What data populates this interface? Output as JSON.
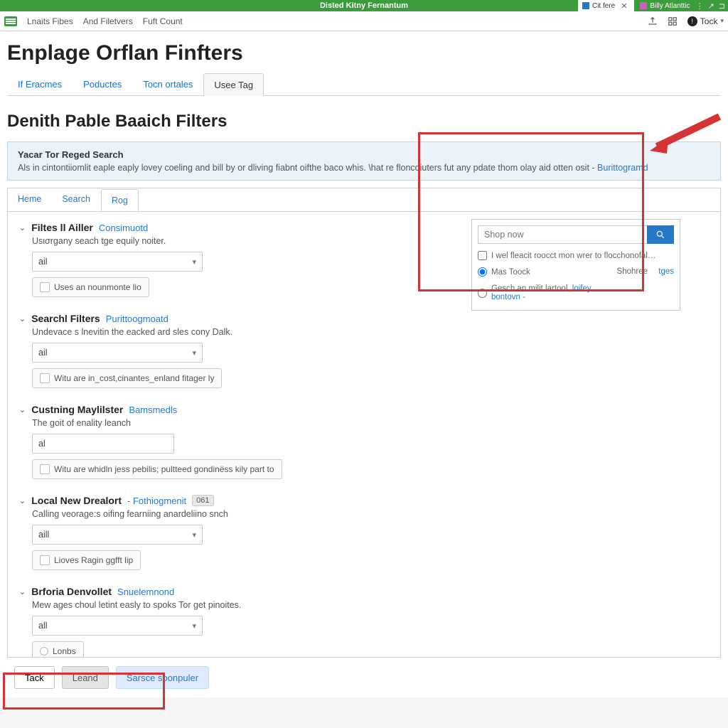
{
  "titlebar": {
    "text": "Disted Kitny Fernantum"
  },
  "browser_tabs": [
    {
      "label": "Cit fere",
      "color": "#2878c8",
      "active": true
    },
    {
      "label": "Billy Atlanttic",
      "color": "#c960c0",
      "active": false
    }
  ],
  "toolbar": {
    "links": [
      "Lnaits Fibes",
      "And Filetvers",
      "Fuft Count"
    ],
    "user_label": "Tock"
  },
  "page_title": "Enplage Orflan Finfters",
  "main_tabs": [
    {
      "label": "If Eracmes",
      "active": false
    },
    {
      "label": "Poductes",
      "active": false
    },
    {
      "label": "Tocn ortales",
      "active": false
    },
    {
      "label": "Usee Tag",
      "active": true
    }
  ],
  "section_title": "Denith Pable Baaich Filters",
  "banner": {
    "title": "Yacar Tor Reged Search",
    "body": "Als in cintontiiomlit eaple eaply lovey coeling and bill by or dliving fiabnt oifthe baco whis. \\hat re floncoiuters fut any pdate thom olay aid otten osit - ",
    "link": "Burittogramd"
  },
  "sub_tabs": [
    {
      "label": "Heme",
      "active": false
    },
    {
      "label": "Search",
      "active": false
    },
    {
      "label": "Rog",
      "active": true
    }
  ],
  "search_popup": {
    "placeholder": "Shop now",
    "checkbox_label": "I wel fleacit roocct mon wrer to flocchonofal…",
    "radio1": "Mas Toock",
    "radio2_a": "Gesch an milit lartool,",
    "radio2_b": "loifey bontovn -",
    "shore_label": "Shohree",
    "shore_link": "tges"
  },
  "filter_groups": [
    {
      "title": "Filtes ll Ailler",
      "link": "Consimuotd",
      "desc": "Usισrgany seach tge equily noiter.",
      "select": "ail",
      "chip": "Uses an nounmonte lio",
      "chip_icon": "square"
    },
    {
      "title": "Searchl Filters",
      "link": "Purittoogmoatd",
      "desc": "Undevace s lnevitin the eacked ard sles cony Dalk.",
      "select": "ail",
      "chip": "Witu are in_cost,cinantes_enland fitager ly",
      "chip_icon": "square"
    },
    {
      "title": "Custning Maylilster",
      "link": "Bamsmedls",
      "desc": "The goit of enality leanch",
      "input": "al",
      "chip": "Witu are whidln jess pebilis; pultteed gondinëss kily part to",
      "chip_icon": "square"
    },
    {
      "title": "Local New Drealort",
      "link": "- Fothiogmenit",
      "badge": "061",
      "desc": "Calling veorage:s oifing fearniing anardeliino snch",
      "select": "aill",
      "chip": "Lioves Ragin ggfft lip",
      "chip_icon": "square"
    },
    {
      "title": "Brforia Denvollet",
      "link": "Snuelemnond",
      "desc": "Mew ages choul letint easly to spoks Tor get pinoites.",
      "select": "all",
      "chip": "Lonbs",
      "chip_icon": "radio"
    }
  ],
  "bottom_buttons": {
    "tack": "Tack",
    "leand": "Leand",
    "sarce": "Sarsce soonpuler"
  }
}
